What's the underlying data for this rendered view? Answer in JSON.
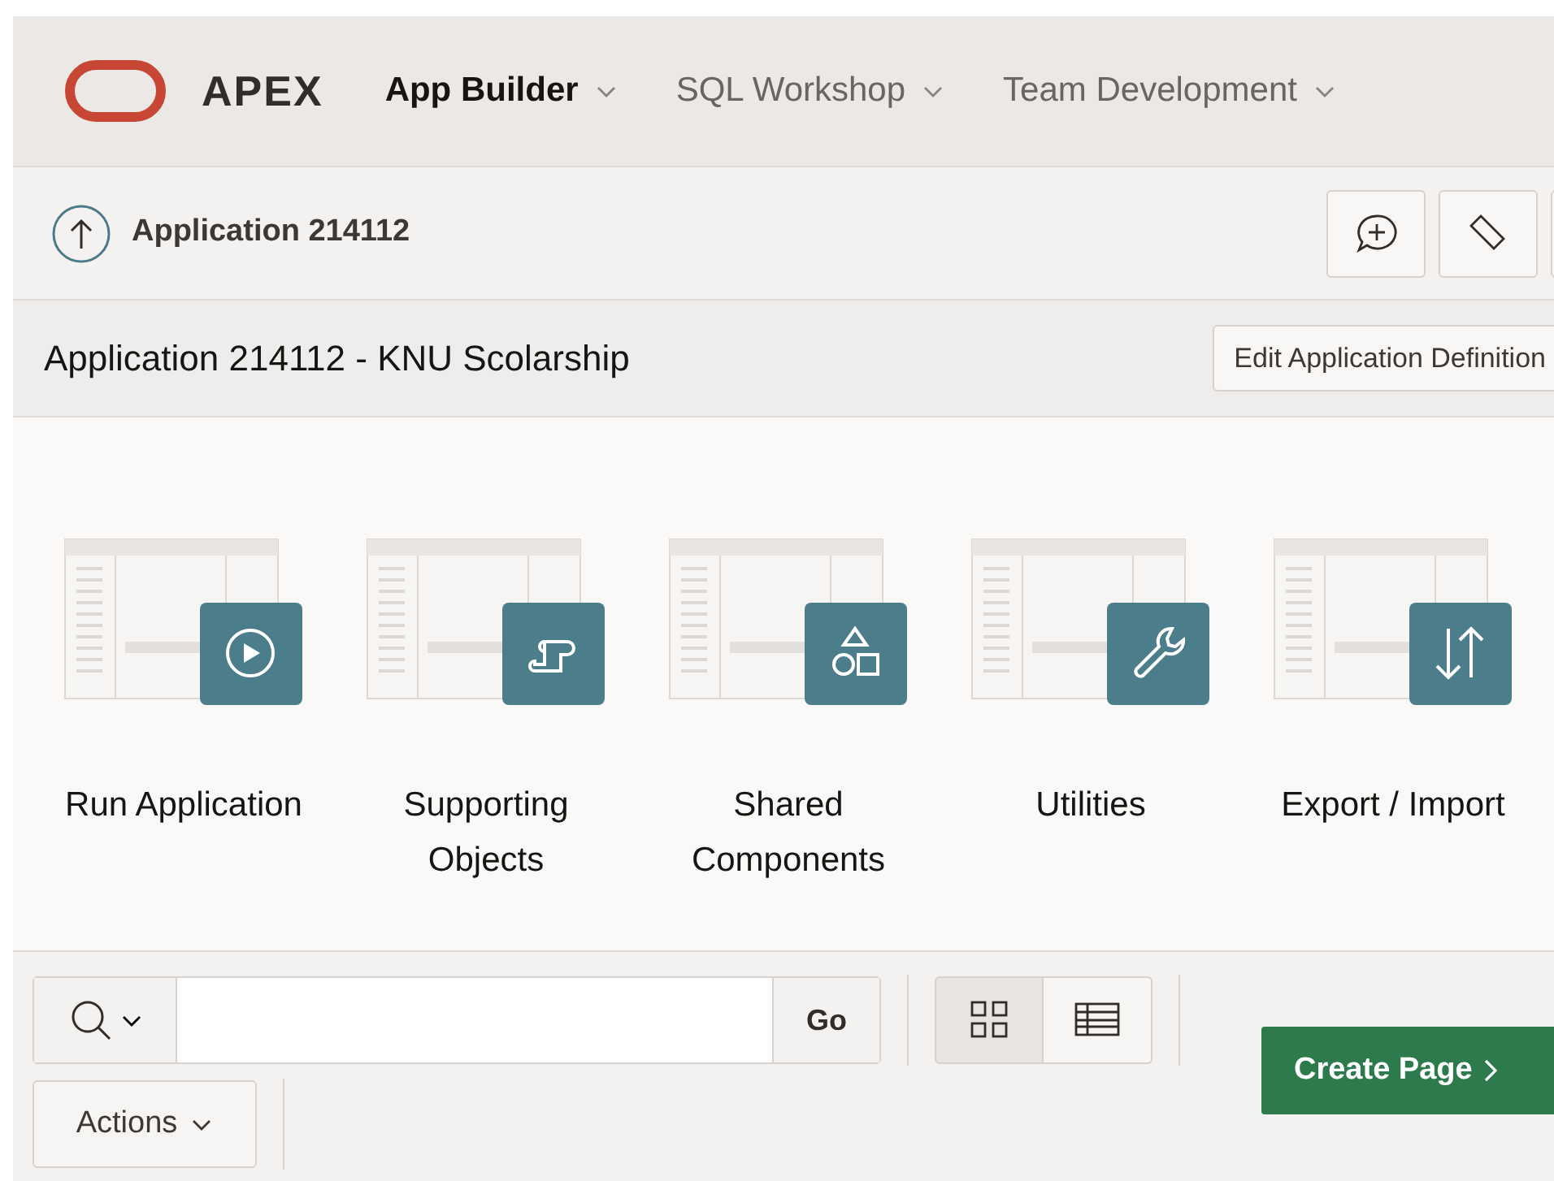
{
  "brand": {
    "name": "APEX"
  },
  "nav": [
    {
      "label": "App Builder",
      "selected": true
    },
    {
      "label": "SQL Workshop",
      "selected": false
    },
    {
      "label": "Team Development",
      "selected": false
    }
  ],
  "breadcrumb": {
    "label": "Application 214112"
  },
  "title_bar": {
    "title": "Application 214112 - KNU Scolarship",
    "button": "Edit Application Definition"
  },
  "tiles": [
    {
      "label": "Run Application",
      "kind": "run"
    },
    {
      "label": "Supporting Objects",
      "kind": "supporting"
    },
    {
      "label": "Shared Components",
      "kind": "shared"
    },
    {
      "label": "Utilities",
      "kind": "utilities"
    },
    {
      "label": "Export / Import",
      "kind": "export"
    }
  ],
  "toolbar": {
    "go": "Go",
    "actions": "Actions",
    "create": "Create Page",
    "views": [
      {
        "kind": "icons",
        "selected": true
      },
      {
        "kind": "report",
        "selected": false
      }
    ]
  }
}
